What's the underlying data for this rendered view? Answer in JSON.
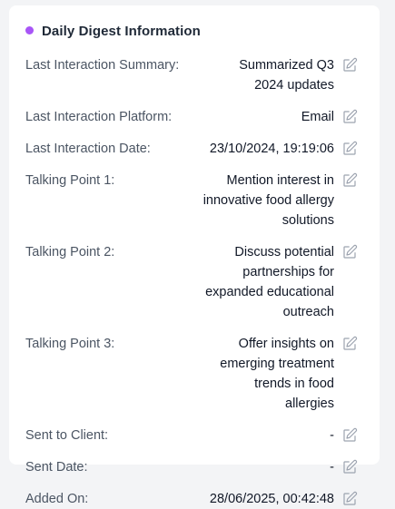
{
  "card": {
    "title": "Daily Digest Information",
    "accent_color": "#a855f7"
  },
  "rows": [
    {
      "label": "Last Interaction Summary:",
      "value": "Summarized Q3 2024 updates",
      "edit_icon": "edit-icon"
    },
    {
      "label": "Last Interaction Platform:",
      "value": "Email",
      "edit_icon": "edit-icon"
    },
    {
      "label": "Last Interaction Date:",
      "value": "23/10/2024, 19:19:06",
      "edit_icon": "edit-icon"
    },
    {
      "label": "Talking Point 1:",
      "value": "Mention interest in innovative food allergy solutions",
      "edit_icon": "edit-icon"
    },
    {
      "label": "Talking Point 2:",
      "value": "Discuss potential partnerships for expanded educational outreach",
      "edit_icon": "edit-icon"
    },
    {
      "label": "Talking Point 3:",
      "value": "Offer insights on emerging treatment trends in food allergies",
      "edit_icon": "edit-icon"
    },
    {
      "label": "Sent to Client:",
      "value": "-",
      "edit_icon": "edit-icon"
    },
    {
      "label": "Sent Date:",
      "value": "-",
      "edit_icon": "edit-icon"
    },
    {
      "label": "Added On:",
      "value": "28/06/2025, 00:42:48",
      "edit_icon": "edit-icon"
    }
  ]
}
